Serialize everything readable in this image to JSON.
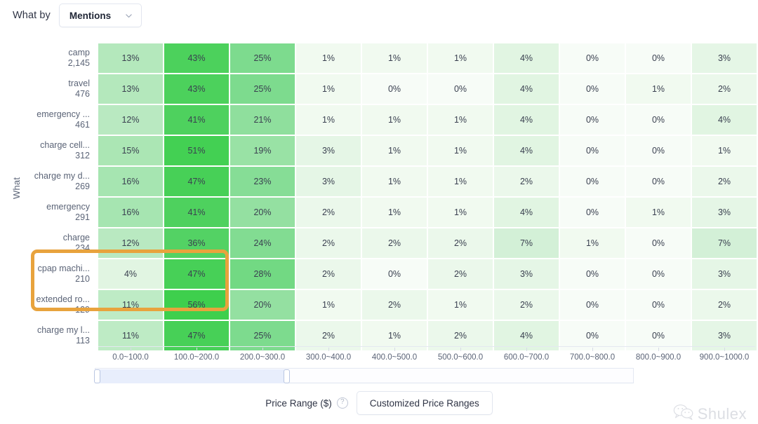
{
  "toolbar": {
    "label": "What by",
    "select_value": "Mentions",
    "chevron_icon": "chevron-down-icon"
  },
  "chart_axis": {
    "y_title": "What"
  },
  "bottom": {
    "price_range_label": "Price Range ($)",
    "help_icon": "question-mark-icon",
    "customized_button": "Customized Price Ranges"
  },
  "watermark": {
    "text": "Shulex",
    "icon": "wechat-bubble-icon"
  },
  "colors": {
    "accent_high": "#3ecf4d",
    "accent_mid": "#7ddb8e",
    "accent_low": "#b4e8bc",
    "accent_faint": "#f1faf0",
    "highlight_border": "#e8a33d",
    "slider_fill": "#e8eefc"
  },
  "chart_data": {
    "type": "heatmap",
    "title": "",
    "xlabel": "Price Range ($)",
    "ylabel": "What",
    "value_unit": "%",
    "legend": "none",
    "grid": false,
    "categories": [
      "0.0~100.0",
      "100.0~200.0",
      "200.0~300.0",
      "300.0~400.0",
      "400.0~500.0",
      "500.0~600.0",
      "600.0~700.0",
      "700.0~800.0",
      "800.0~900.0",
      "900.0~1000.0"
    ],
    "rows": [
      {
        "label": "camp",
        "count": "2,145",
        "values": [
          "13%",
          "43%",
          "25%",
          "1%",
          "1%",
          "1%",
          "4%",
          "0%",
          "0%",
          "3%"
        ],
        "nums": [
          13,
          43,
          25,
          1,
          1,
          1,
          4,
          0,
          0,
          3
        ]
      },
      {
        "label": "travel",
        "count": "476",
        "values": [
          "13%",
          "43%",
          "25%",
          "1%",
          "0%",
          "0%",
          "4%",
          "0%",
          "1%",
          "2%"
        ],
        "nums": [
          13,
          43,
          25,
          1,
          0,
          0,
          4,
          0,
          1,
          2
        ]
      },
      {
        "label": "emergency ...",
        "count": "461",
        "values": [
          "12%",
          "41%",
          "21%",
          "1%",
          "1%",
          "1%",
          "4%",
          "0%",
          "0%",
          "4%"
        ],
        "nums": [
          12,
          41,
          21,
          1,
          1,
          1,
          4,
          0,
          0,
          4
        ]
      },
      {
        "label": "charge cell...",
        "count": "312",
        "values": [
          "15%",
          "51%",
          "19%",
          "3%",
          "1%",
          "1%",
          "4%",
          "0%",
          "0%",
          "1%"
        ],
        "nums": [
          15,
          51,
          19,
          3,
          1,
          1,
          4,
          0,
          0,
          1
        ]
      },
      {
        "label": "charge my d...",
        "count": "269",
        "values": [
          "16%",
          "47%",
          "23%",
          "3%",
          "1%",
          "1%",
          "2%",
          "0%",
          "0%",
          "2%"
        ],
        "nums": [
          16,
          47,
          23,
          3,
          1,
          1,
          2,
          0,
          0,
          2
        ]
      },
      {
        "label": "emergency",
        "count": "291",
        "values": [
          "16%",
          "41%",
          "20%",
          "2%",
          "1%",
          "1%",
          "4%",
          "0%",
          "1%",
          "3%"
        ],
        "nums": [
          16,
          41,
          20,
          2,
          1,
          1,
          4,
          0,
          1,
          3
        ]
      },
      {
        "label": "charge",
        "count": "234",
        "values": [
          "12%",
          "36%",
          "24%",
          "2%",
          "2%",
          "2%",
          "7%",
          "1%",
          "0%",
          "7%"
        ],
        "nums": [
          12,
          36,
          24,
          2,
          2,
          2,
          7,
          1,
          0,
          7
        ]
      },
      {
        "label": "cpap machi...",
        "count": "210",
        "values": [
          "4%",
          "47%",
          "28%",
          "2%",
          "0%",
          "2%",
          "3%",
          "0%",
          "0%",
          "3%"
        ],
        "nums": [
          4,
          47,
          28,
          2,
          0,
          2,
          3,
          0,
          0,
          3
        ]
      },
      {
        "label": "extended ro...",
        "count": "129",
        "values": [
          "11%",
          "56%",
          "20%",
          "1%",
          "2%",
          "1%",
          "2%",
          "0%",
          "0%",
          "2%"
        ],
        "nums": [
          11,
          56,
          20,
          1,
          2,
          1,
          2,
          0,
          0,
          2
        ]
      },
      {
        "label": "charge my l...",
        "count": "113",
        "values": [
          "11%",
          "47%",
          "25%",
          "2%",
          "1%",
          "2%",
          "4%",
          "0%",
          "0%",
          "3%"
        ],
        "nums": [
          11,
          47,
          25,
          2,
          1,
          2,
          4,
          0,
          0,
          3
        ]
      }
    ],
    "highlight": {
      "rows": [
        7,
        8
      ],
      "cols": [
        0,
        1
      ]
    }
  }
}
